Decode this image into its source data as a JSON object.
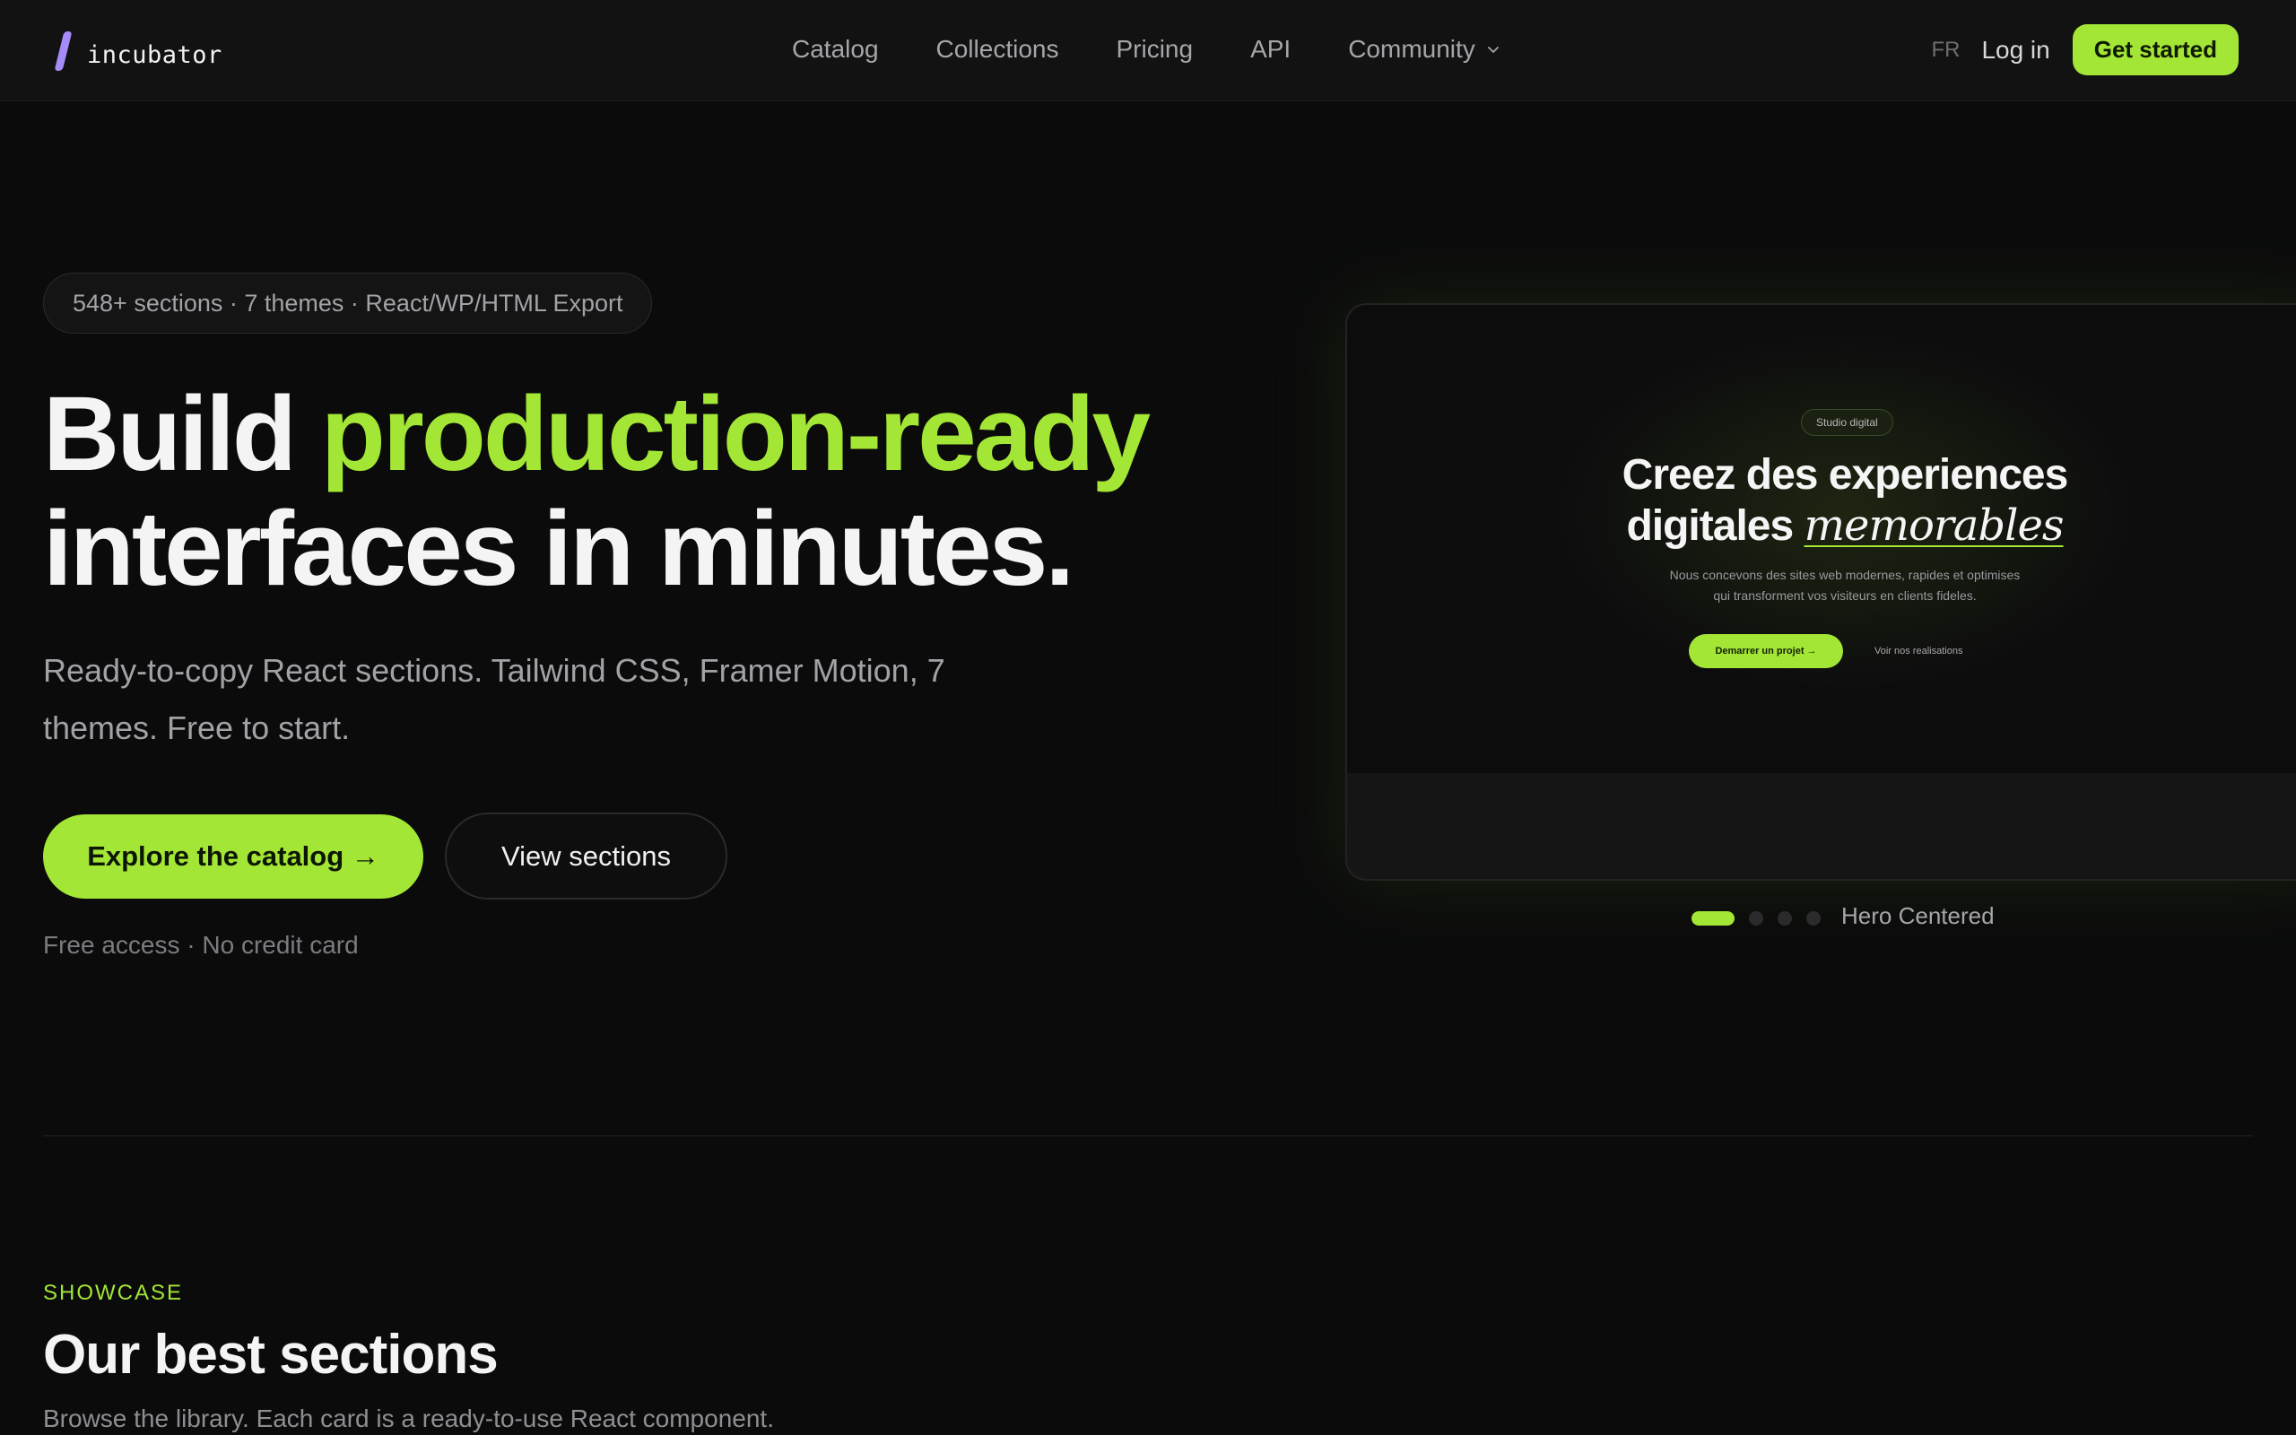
{
  "nav": {
    "logo_text": "incubator",
    "links": [
      "Catalog",
      "Collections",
      "Pricing",
      "API",
      "Community"
    ],
    "lang": "FR",
    "login": "Log in",
    "cta": "Get started"
  },
  "hero": {
    "pill": "548+ sections · 7 themes · React/WP/HTML Export",
    "title_part1": "Build",
    "title_accent": "production-ready",
    "title_part2": "interfaces in minutes.",
    "subtitle": "Ready-to-copy React sections. Tailwind CSS, Framer Motion, 7 themes. Free to start.",
    "primary_button": "Explore the catalog →",
    "secondary_button": "View sections",
    "note": "Free access · No credit card"
  },
  "preview": {
    "badge": "Studio digital",
    "title_line1": "Creez des experiences",
    "title_line2": "digitales",
    "title_italic": "memorables",
    "desc_line1": "Nous concevons des sites web modernes, rapides et optimises",
    "desc_line2": "qui transforment vos visiteurs en clients fideles.",
    "primary_button": "Demarrer un projet →",
    "secondary_link": "Voir nos realisations",
    "carousel_label": "Hero Centered",
    "carousel_total": 4,
    "carousel_active": 1
  },
  "showcase": {
    "eyebrow": "SHOWCASE",
    "title": "Our best sections",
    "subtitle": "Browse the library. Each card is a ready-to-use React component."
  },
  "colors": {
    "accent": "#a3e635",
    "logo_accent": "#a78bfa",
    "background": "#0b0b0c"
  }
}
